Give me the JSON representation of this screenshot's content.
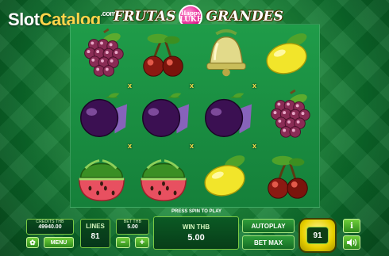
{
  "watermark": {
    "slot": "Slot",
    "catalog": "Catalog",
    "com": ".com"
  },
  "title": {
    "left": "FRUTAS",
    "badge_top": "Happy",
    "badge_main": "LUKE",
    "right": "GRANDES"
  },
  "reels": {
    "rows": [
      [
        "grapes",
        "cherries",
        "bell",
        "lemon"
      ],
      [
        "plum",
        "plum",
        "plum",
        "grapes"
      ],
      [
        "watermelon",
        "watermelon",
        "lemon",
        "cherries"
      ]
    ],
    "x_marker": "x"
  },
  "panel": {
    "credits_label": "CREDITS THB",
    "credits_value": "49940.00",
    "menu_label": "MENU",
    "lines_label": "LINES",
    "lines_value": "81",
    "bet_label": "BET THB",
    "bet_value": "5.00",
    "minus": "−",
    "plus": "+",
    "press_spin": "PRESS SPIN TO PLAY",
    "win_label": "WIN THB",
    "win_value": "5.00",
    "autoplay_label": "AUTOPLAY",
    "bet_max_label": "BET MAX",
    "spin_count": "91",
    "info": "i",
    "settings_icon": "gear-icon",
    "sound_icon": "speaker-icon"
  },
  "colors": {
    "accent_green": "#7ac943",
    "spin_yellow": "#e8d000",
    "felt": "#1f9c49"
  }
}
